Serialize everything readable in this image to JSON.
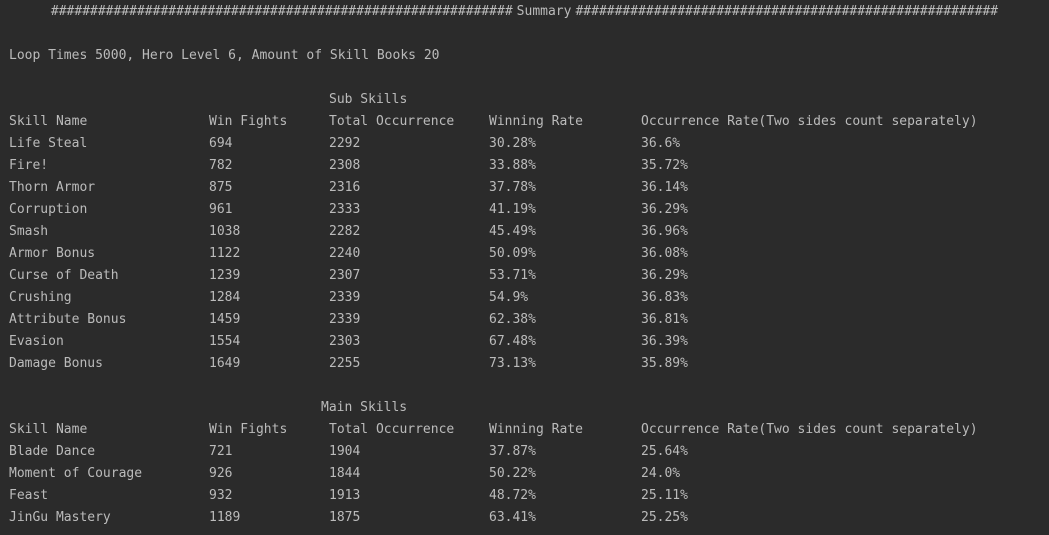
{
  "summary_header": {
    "title": "Summary",
    "left_hashes": "###########################################################",
    "right_hashes": "######################################################"
  },
  "info_line": "Loop Times 5000, Hero Level 6, Amount of Skill Books 20",
  "columns": [
    "Skill Name",
    "Win Fights",
    "Total Occurrence",
    "Winning Rate",
    "Occurrence Rate(Two sides count separately)"
  ],
  "sub_skills": {
    "title": "Sub Skills",
    "rows": [
      [
        "Life Steal",
        "694",
        "2292",
        "30.28%",
        "36.6%"
      ],
      [
        "Fire!",
        "782",
        "2308",
        "33.88%",
        "35.72%"
      ],
      [
        "Thorn Armor",
        "875",
        "2316",
        "37.78%",
        "36.14%"
      ],
      [
        "Corruption",
        "961",
        "2333",
        "41.19%",
        "36.29%"
      ],
      [
        "Smash",
        "1038",
        "2282",
        "45.49%",
        "36.96%"
      ],
      [
        "Armor Bonus",
        "1122",
        "2240",
        "50.09%",
        "36.08%"
      ],
      [
        "Curse of Death",
        "1239",
        "2307",
        "53.71%",
        "36.29%"
      ],
      [
        "Crushing",
        "1284",
        "2339",
        "54.9%",
        "36.83%"
      ],
      [
        "Attribute Bonus",
        "1459",
        "2339",
        "62.38%",
        "36.81%"
      ],
      [
        "Evasion",
        "1554",
        "2303",
        "67.48%",
        "36.39%"
      ],
      [
        "Damage Bonus",
        "1649",
        "2255",
        "73.13%",
        "35.89%"
      ]
    ]
  },
  "main_skills": {
    "title": "Main Skills",
    "rows": [
      [
        "Blade Dance",
        "721",
        "1904",
        "37.87%",
        "25.64%"
      ],
      [
        "Moment of Courage",
        "926",
        "1844",
        "50.22%",
        "24.0%"
      ],
      [
        "Feast",
        "932",
        "1913",
        "48.72%",
        "25.11%"
      ],
      [
        "JinGu Mastery",
        "1189",
        "1875",
        "63.41%",
        "25.25%"
      ]
    ]
  }
}
